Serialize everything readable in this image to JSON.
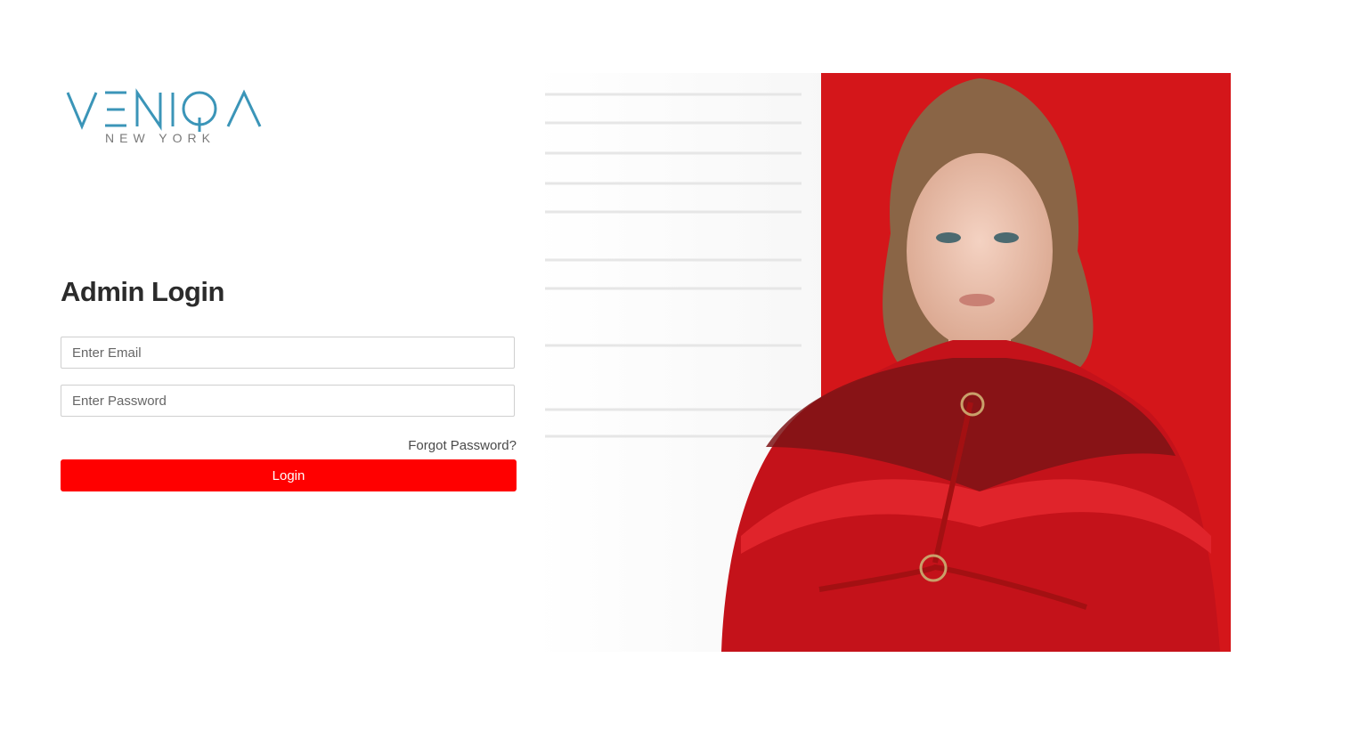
{
  "logo": {
    "brand": "VENIQA",
    "tagline": "NEW YORK",
    "brand_color": "#3b95b8",
    "tagline_color": "#7a7a7a"
  },
  "login": {
    "title": "Admin Login",
    "email_placeholder": "Enter Email",
    "email_value": "",
    "password_placeholder": "Enter Password",
    "password_value": "",
    "forgot_label": "Forgot Password?",
    "login_label": "Login",
    "accent_color": "#ff0000"
  },
  "hero": {
    "icon": "fashion-model-photo",
    "background_color": "#d4161a"
  }
}
